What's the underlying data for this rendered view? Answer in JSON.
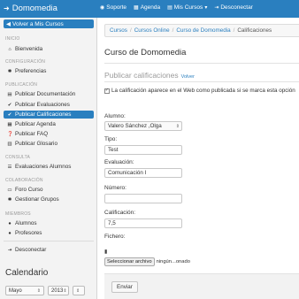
{
  "brand": {
    "icon": "arrow-right-icon",
    "title": "Domomedia"
  },
  "topnav": [
    {
      "icon": "globe-icon",
      "label": "Soporte"
    },
    {
      "icon": "calendar-icon",
      "label": "Agenda"
    },
    {
      "icon": "book-icon",
      "label": "Mis Cursos",
      "caret": "▾"
    },
    {
      "icon": "signout-icon",
      "label": "Desconectar"
    }
  ],
  "sidebar": {
    "back_label": "Volver a Mis Cursos",
    "sections": {
      "inicio": "INICIO",
      "configuracion": "CONFIGURACIÓN",
      "publicacion": "PUBLICACIÓN",
      "consulta": "CONSULTA",
      "colaboracion": "COLABORACIÓN",
      "miembros": "MIEMBROS"
    },
    "items": [
      {
        "icon": "home-icon",
        "label": "Bienvenida"
      },
      {
        "icon": "gear-icon",
        "label": "Preferencias"
      },
      {
        "icon": "document-icon",
        "label": "Publicar Documentación"
      },
      {
        "icon": "check-icon",
        "label": "Publicar Evaluaciones"
      },
      {
        "icon": "check-icon",
        "label": "Publicar Calificaciones",
        "active": true
      },
      {
        "icon": "calendar-icon",
        "label": "Publicar Agenda"
      },
      {
        "icon": "question-icon",
        "label": "Publicar FAQ"
      },
      {
        "icon": "book-icon",
        "label": "Publicar Glosario"
      },
      {
        "icon": "list-icon",
        "label": "Evaluaciones Alumnos"
      },
      {
        "icon": "chat-icon",
        "label": "Foro Curso"
      },
      {
        "icon": "gear-icon",
        "label": "Gestionar Grupos"
      },
      {
        "icon": "user-icon",
        "label": "Alumnos"
      },
      {
        "icon": "user-icon",
        "label": "Profesores"
      },
      {
        "icon": "signout-icon",
        "label": "Desconectar"
      }
    ],
    "calendar": {
      "title": "Calendario",
      "month": "Mayo",
      "year": "2013"
    }
  },
  "breadcrumb": [
    "Cursos",
    "Cursos Online",
    "Curso de Domomedia",
    "Calificaciones"
  ],
  "main": {
    "page_title": "Curso de Domomedia",
    "section_title": "Publicar calificaciones",
    "section_link": "Volver",
    "publish_checkbox": {
      "checked": true,
      "label": "La calificación aparece en el Web como publicada si se marca esta opción"
    },
    "fields": {
      "alumno": {
        "label": "Alumno:",
        "value": "Valero Sánchez ,Olga"
      },
      "tipo": {
        "label": "Tipo:",
        "value": "Test"
      },
      "evaluacion": {
        "label": "Evaluación:",
        "value": "Comunicación I"
      },
      "numero": {
        "label": "Número:",
        "value": ""
      },
      "calificacion": {
        "label": "Calificación:",
        "value": "7,5"
      },
      "fichero": {
        "label": "Fichero:",
        "button": "Seleccionar archivo",
        "status": "ningún...onado"
      }
    },
    "submit_label": "Enviar"
  }
}
